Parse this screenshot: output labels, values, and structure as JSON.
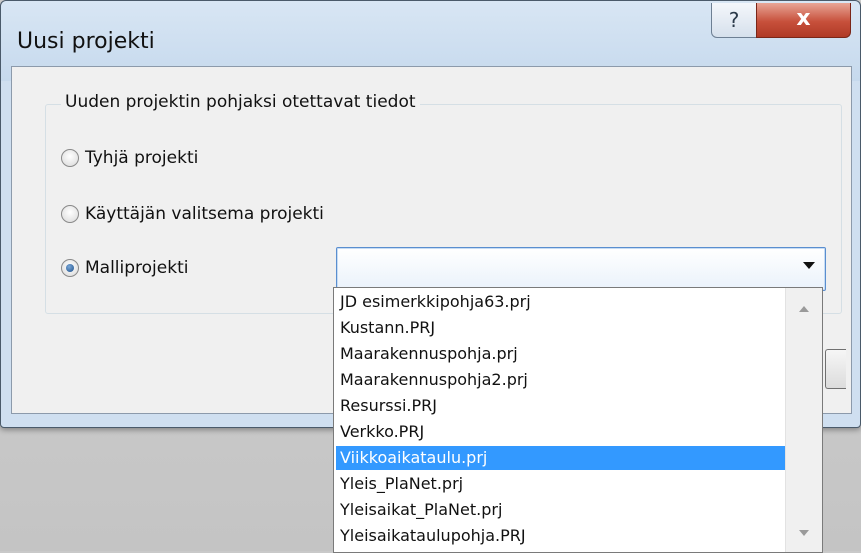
{
  "window": {
    "title": "Uusi projekti",
    "help_label": "?",
    "close_label": "x"
  },
  "group": {
    "label": "Uuden projektin pohjaksi otettavat tiedot"
  },
  "radios": [
    {
      "label": "Tyhjä projekti",
      "checked": false
    },
    {
      "label": "Käyttäjän valitsema projekti",
      "checked": false
    },
    {
      "label": "Malliprojekti",
      "checked": true
    }
  ],
  "combo": {
    "value": "",
    "icon": "chevron-down-icon"
  },
  "dropdown": {
    "items": [
      "JD esimerkkipohja63.prj",
      "Kustann.PRJ",
      "Maarakennuspohja.prj",
      "Maarakennuspohja2.prj",
      "Resurssi.PRJ",
      "Verkko.PRJ",
      "Viikkoaikataulu.prj",
      "Yleis_PlaNet.prj",
      "Yleisaikat_PlaNet.prj",
      "Yleisaikataulupohja.PRJ"
    ],
    "selected_index": 6
  },
  "colors": {
    "selection": "#3399ff",
    "close_button": "#c7503b",
    "dialog_face": "#f0f0f0"
  }
}
